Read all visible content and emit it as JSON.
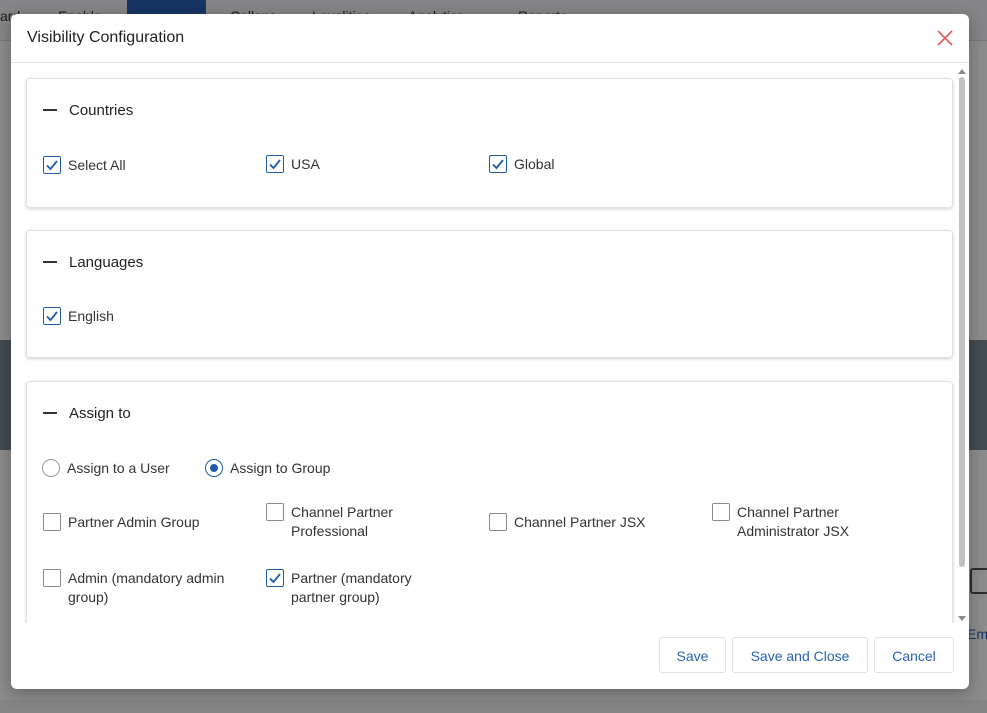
{
  "background": {
    "nav_items": [
      "ard",
      "Enable",
      "Market",
      "Collaps",
      "Loyalities",
      "Analytics",
      "Reports"
    ],
    "side_link": "Em"
  },
  "dialog": {
    "title": "Visibility Configuration",
    "countries": {
      "title": "Countries",
      "options": [
        {
          "label": "Select All",
          "checked": true
        },
        {
          "label": "USA",
          "checked": true
        },
        {
          "label": "Global",
          "checked": true
        }
      ]
    },
    "languages": {
      "title": "Languages",
      "options": [
        {
          "label": "English",
          "checked": true
        }
      ]
    },
    "assign": {
      "title": "Assign to",
      "modes": [
        {
          "label": "Assign to a User",
          "selected": false
        },
        {
          "label": "Assign to Group",
          "selected": true
        }
      ],
      "groups": [
        {
          "label": "Partner Admin Group",
          "checked": false
        },
        {
          "label": "Channel Partner Professional",
          "checked": false
        },
        {
          "label": "Channel Partner JSX",
          "checked": false
        },
        {
          "label": "Channel Partner Administrator JSX",
          "checked": false
        },
        {
          "label": "Admin (mandatory admin group)",
          "checked": false
        },
        {
          "label": "Partner (mandatory partner group)",
          "checked": true
        }
      ]
    },
    "footer": {
      "save": "Save",
      "save_close": "Save and Close",
      "cancel": "Cancel"
    }
  },
  "colors": {
    "accent": "#1f5da8",
    "link": "#2a63b8",
    "close_icon": "#e05a5a"
  }
}
